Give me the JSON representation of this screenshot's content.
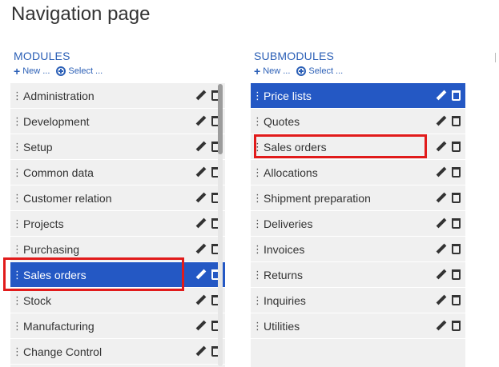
{
  "page": {
    "title": "Navigation page"
  },
  "modules": {
    "heading": "MODULES",
    "new_label": "New ...",
    "select_label": "Select ...",
    "items": [
      {
        "label": "Administration"
      },
      {
        "label": "Development"
      },
      {
        "label": "Setup"
      },
      {
        "label": "Common data"
      },
      {
        "label": "Customer relation"
      },
      {
        "label": "Projects"
      },
      {
        "label": "Purchasing"
      },
      {
        "label": "Sales orders",
        "selected": true
      },
      {
        "label": "Stock"
      },
      {
        "label": "Manufacturing"
      },
      {
        "label": "Change Control"
      }
    ]
  },
  "submodules": {
    "heading": "SUBMODULES",
    "new_label": "New ...",
    "select_label": "Select ...",
    "items": [
      {
        "label": "Price lists",
        "selected": true
      },
      {
        "label": "Quotes"
      },
      {
        "label": "Sales orders",
        "highlighted": true
      },
      {
        "label": "Allocations"
      },
      {
        "label": "Shipment preparation"
      },
      {
        "label": "Deliveries"
      },
      {
        "label": "Invoices"
      },
      {
        "label": "Returns"
      },
      {
        "label": "Inquiries"
      },
      {
        "label": "Utilities"
      }
    ]
  },
  "colors": {
    "accent": "#2458c4",
    "link": "#2b5fb6",
    "row_bg": "#f0f0f0",
    "highlight_box": "#e11b1b"
  },
  "icons": [
    "plus-icon",
    "zoom-plus-icon",
    "pencil-icon",
    "trash-icon",
    "grip-icon"
  ]
}
